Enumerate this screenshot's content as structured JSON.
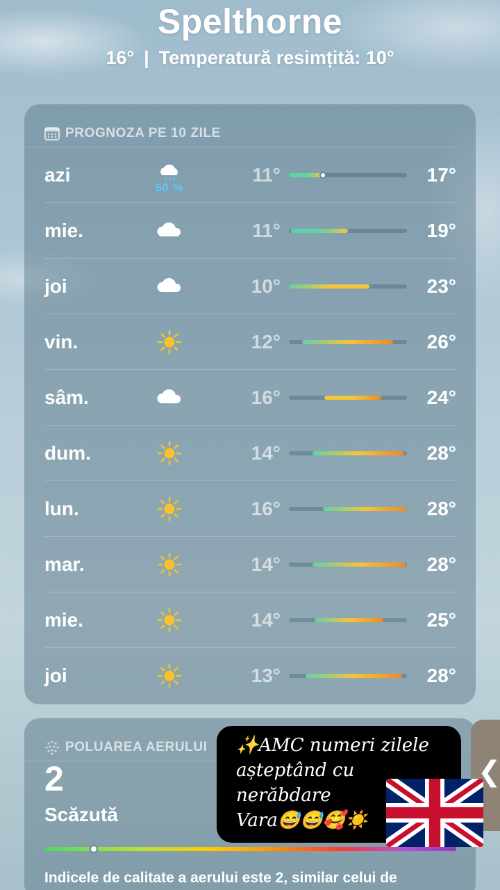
{
  "location": {
    "city": "Spelthorne",
    "current_temp": "16°",
    "separator": "|",
    "feels_like": "Temperatură resimțită: 10°"
  },
  "forecast": {
    "title": "PROGNOZA PE 10 ZILE",
    "icon": "calendar-icon",
    "days": [
      {
        "day": "azi",
        "icon": "cloud-rain-icon",
        "precip": "50 %",
        "low": "11°",
        "high": "17°",
        "range": [
          0.0,
          0.3
        ],
        "current": 0.29
      },
      {
        "day": "mie.",
        "icon": "cloud-icon",
        "low": "11°",
        "high": "19°",
        "range": [
          0.02,
          0.5
        ]
      },
      {
        "day": "joi",
        "icon": "cloud-icon",
        "low": "10°",
        "high": "23°",
        "range": [
          0.0,
          0.68
        ]
      },
      {
        "day": "vin.",
        "icon": "sun-icon",
        "low": "12°",
        "high": "26°",
        "range": [
          0.11,
          0.88
        ]
      },
      {
        "day": "sâm.",
        "icon": "cloud-icon",
        "low": "16°",
        "high": "24°",
        "range": [
          0.3,
          0.78
        ]
      },
      {
        "day": "dum.",
        "icon": "sun-icon",
        "low": "14°",
        "high": "28°",
        "range": [
          0.2,
          0.97
        ]
      },
      {
        "day": "lun.",
        "icon": "sun-icon",
        "low": "16°",
        "high": "28°",
        "range": [
          0.29,
          1.0
        ]
      },
      {
        "day": "mar.",
        "icon": "sun-icon",
        "low": "14°",
        "high": "28°",
        "range": [
          0.2,
          0.99
        ]
      },
      {
        "day": "mie.",
        "icon": "sun-icon",
        "low": "14°",
        "high": "25°",
        "range": [
          0.22,
          0.8
        ]
      },
      {
        "day": "joi",
        "icon": "sun-icon",
        "low": "13°",
        "high": "28°",
        "range": [
          0.14,
          0.96
        ]
      }
    ]
  },
  "air_quality": {
    "title": "POLUAREA AERULUI",
    "icon": "air-quality-icon",
    "value": "2",
    "level": "Scăzută",
    "indicator": 0.12,
    "description": "Indicele de calitate a aerului este 2, similar celui de"
  },
  "story_overlay": {
    "caption_lines": [
      "✨AMC numeri zilele",
      "așteptând cu",
      "nerăbdare",
      "Vara😅😅🥰☀️"
    ],
    "flag": "uk-flag",
    "side_tab_icon": "chevron-left-icon",
    "side_tab_glyph": "❮"
  },
  "colors": {
    "precip": "#5ac8fa",
    "cool": "#5fd3a5",
    "mild": "#f2c53d",
    "warm": "#f08a24"
  }
}
